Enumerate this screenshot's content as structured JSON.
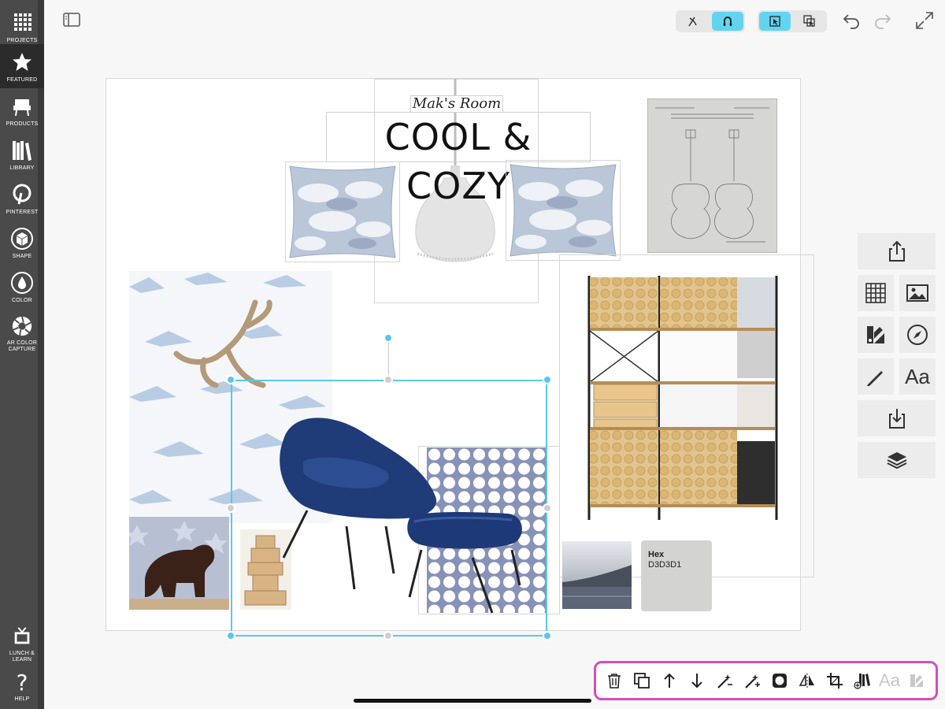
{
  "sidebar": {
    "items": [
      {
        "label": "PROJECTS",
        "icon": "grid-icon"
      },
      {
        "label": "FEATURED",
        "icon": "star-icon",
        "active": true
      },
      {
        "label": "PRODUCTS",
        "icon": "chair-icon"
      },
      {
        "label": "LIBRARY",
        "icon": "books-icon"
      },
      {
        "label": "PINTEREST",
        "icon": "pinterest-icon"
      },
      {
        "label": "SHAPE",
        "icon": "cube-icon"
      },
      {
        "label": "COLOR",
        "icon": "droplet-icon"
      },
      {
        "label": "AR COLOR CAPTURE",
        "icon": "aperture-icon"
      }
    ],
    "bottom": [
      {
        "label": "LUNCH & LEARN",
        "icon": "tv-icon"
      },
      {
        "label": "HELP",
        "icon": "question-icon"
      }
    ]
  },
  "topbar": {
    "snap_group": [
      "draw-icon",
      "magnet-icon"
    ],
    "select_group": [
      "select-icon",
      "multi-select-icon"
    ],
    "actions": [
      "undo-icon",
      "redo-icon",
      "fullscreen-icon"
    ]
  },
  "canvas": {
    "subtitle": "Mak's Room",
    "title": "COOL & COZY",
    "swatch": {
      "label": "Hex",
      "value": "D3D3D1",
      "color": "#D3D3D1"
    }
  },
  "right_toolbar": {
    "items": [
      "share-icon",
      "grid-icon",
      "image-icon",
      "shapes-icon",
      "compass-icon",
      "pen-icon",
      "text-icon",
      "import-icon",
      "layers-icon"
    ],
    "text_label": "Aa"
  },
  "bottom_toolbar": {
    "items": [
      "trash-icon",
      "duplicate-icon",
      "bring-forward-icon",
      "send-backward-icon",
      "magic-remove-icon",
      "magic-add-icon",
      "mask-icon",
      "flip-icon",
      "crop-icon",
      "add-to-library-icon",
      "text-style-icon",
      "color-shapes-icon"
    ],
    "text_label": "Aa"
  },
  "colors": {
    "accent": "#5BC7EA",
    "highlight": "#CF50C1",
    "sidebar": "#4A4A4A"
  }
}
